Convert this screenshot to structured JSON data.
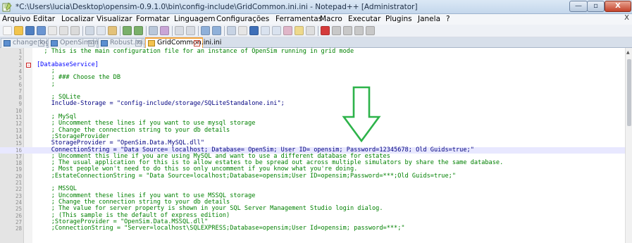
{
  "window": {
    "title": "*C:\\Users\\lucia\\Desktop\\opensim-0.9.1.0\\bin\\config-include\\GridCommon.ini.ini - Notepad++ [Administrator]",
    "minimize_label": "—",
    "maximize_label": "▫",
    "close_label": "X"
  },
  "menu": [
    "Arquivo",
    "Editar",
    "Localizar",
    "Visualizar",
    "Formatar",
    "Linguagem",
    "Configurações",
    "Ferramentas",
    "Macro",
    "Executar",
    "Plugins",
    "Janela",
    "?"
  ],
  "menu_close": "X",
  "toolbar": [
    "new-file",
    "open-file",
    "save",
    "save-all",
    "close",
    "close-all",
    "print",
    "cut",
    "copy",
    "paste",
    "undo",
    "redo",
    "find",
    "replace",
    "zoom-in",
    "zoom-out",
    "sync-vertical",
    "sync-horizontal",
    "word-wrap",
    "show-all-chars",
    "indent-guide",
    "user-defined-language",
    "doc-map",
    "function-list",
    "folder-as-workspace",
    "record-macro",
    "stop-recording",
    "play-macro",
    "run-macro-multiple",
    "save-macro"
  ],
  "tabs": [
    {
      "label": "change.log",
      "active": false,
      "close": "X"
    },
    {
      "label": "OpenSim.ini",
      "active": false,
      "close": "X"
    },
    {
      "label": "Robust.ini.ini",
      "active": false,
      "close": "X"
    },
    {
      "label": "GridCommon.ini.ini",
      "active": true,
      "close": "X"
    }
  ],
  "editor": {
    "fold_marker": "−",
    "highlighted_line": 16,
    "lines": [
      {
        "n": "1",
        "text": "  ; This is the main configuration file for an instance of OpenSim running in grid mode",
        "kind": "comment"
      },
      {
        "n": "2",
        "text": "",
        "kind": "plain"
      },
      {
        "n": "3",
        "text": "[DatabaseService]",
        "kind": "section"
      },
      {
        "n": "4",
        "text": "    ;",
        "kind": "comment"
      },
      {
        "n": "5",
        "text": "    ; ### Choose the DB",
        "kind": "comment"
      },
      {
        "n": "6",
        "text": "    ;",
        "kind": "comment"
      },
      {
        "n": "7",
        "text": "",
        "kind": "plain"
      },
      {
        "n": "8",
        "text": "    ; SQLite",
        "kind": "comment"
      },
      {
        "n": "9",
        "text": "    Include-Storage = \"config-include/storage/SQLiteStandalone.ini\";",
        "kind": "plain"
      },
      {
        "n": "10",
        "text": "",
        "kind": "plain"
      },
      {
        "n": "11",
        "text": "    ; MySql",
        "kind": "comment"
      },
      {
        "n": "12",
        "text": "    ; Uncomment these lines if you want to use mysql storage",
        "kind": "comment"
      },
      {
        "n": "13",
        "text": "    ; Change the connection string to your db details",
        "kind": "comment"
      },
      {
        "n": "14",
        "text": "    ;StorageProvider",
        "kind": "comment"
      },
      {
        "n": "15",
        "text": "    StorageProvider = \"OpenSim.Data.MySQL.dll\"",
        "kind": "plain"
      },
      {
        "n": "16",
        "text": "    ConnectionString = \"Data Source= localhost; Database= OpenSim; User ID= opensim; Password=12345678; Old Guids=true;\"",
        "kind": "plain"
      },
      {
        "n": "17",
        "text": "    ; Uncomment this line if you are using MySQL and want to use a different database for estates",
        "kind": "comment"
      },
      {
        "n": "18",
        "text": "    ; The usual application for this is to allow estates to be spread out across multiple simulators by share the same database.",
        "kind": "comment"
      },
      {
        "n": "19",
        "text": "    ; Most people won't need to do this so only uncomment if you know what you're doing.",
        "kind": "comment"
      },
      {
        "n": "20",
        "text": "    ;EstateConnectionString = \"Data Source=localhost;Database=opensim;User ID=opensim;Password=***;Old Guids=true;\"",
        "kind": "comment"
      },
      {
        "n": "21",
        "text": "",
        "kind": "plain"
      },
      {
        "n": "22",
        "text": "    ; MSSQL",
        "kind": "comment"
      },
      {
        "n": "23",
        "text": "    ; Uncomment these lines if you want to use MSSQL storage",
        "kind": "comment"
      },
      {
        "n": "24",
        "text": "    ; Change the connection string to your db details",
        "kind": "comment"
      },
      {
        "n": "25",
        "text": "    ; The value for server property is shown in your SQL Server Management Studio login dialog.",
        "kind": "comment"
      },
      {
        "n": "26",
        "text": "    ; (This sample is the default of express edition)",
        "kind": "comment"
      },
      {
        "n": "27",
        "text": "    ;StorageProvider = \"OpenSim.Data.MSSQL.dll\"",
        "kind": "comment"
      },
      {
        "n": "28",
        "text": "    ;ConnectionString = \"Server=localhost\\SQLEXPRESS;Database=opensim;User Id=opensim; password=***;\"",
        "kind": "comment"
      }
    ]
  },
  "annotation": {
    "shape": "down-arrow",
    "color": "#2db34a"
  }
}
